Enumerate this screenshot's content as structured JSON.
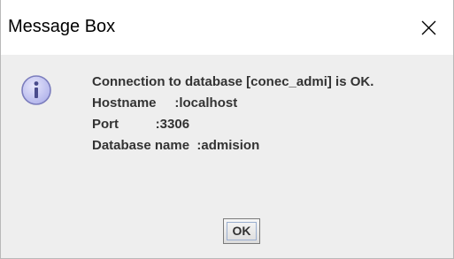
{
  "window": {
    "title": "Message Box"
  },
  "message": {
    "lines": [
      "Connection to database [conec_admi] is OK.",
      "Hostname     :localhost",
      "Port          :3306",
      "Database name  :admision"
    ]
  },
  "buttons": {
    "ok_label": "OK"
  },
  "icons": {
    "title_close": "close-icon",
    "message_type": "information-icon"
  },
  "colors": {
    "dialog_background": "#eeeeee",
    "titlebar_background": "#ffffff",
    "info_icon_fill": "#c8c9f2",
    "info_icon_border": "#7b7dbd",
    "message_text": "#333333"
  }
}
